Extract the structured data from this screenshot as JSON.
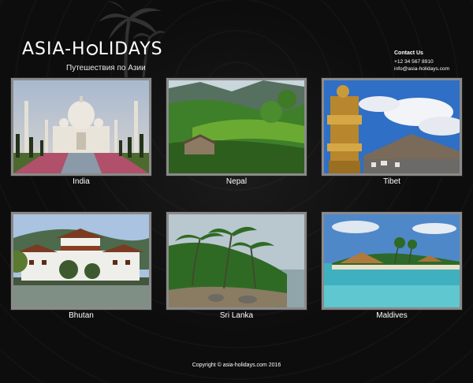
{
  "header": {
    "logo_before": "ASIA-H",
    "logo_after": "LIDAYS",
    "subtitle": "Путешествия по Азии"
  },
  "contact": {
    "title": "Contact Us",
    "phone": "+12 34 567 8910",
    "email": "info@asia-holidays.com"
  },
  "destinations": [
    {
      "name": "India"
    },
    {
      "name": "Nepal"
    },
    {
      "name": "Tibet"
    },
    {
      "name": "Bhutan"
    },
    {
      "name": "Sri Lanka"
    },
    {
      "name": "Maldives"
    }
  ],
  "footer": {
    "copyright": "Copyright © asia-holidays.com 2016"
  },
  "colors": {
    "background": "#0d0d0d",
    "frame": "#8a8a8a",
    "text": "#ffffff"
  },
  "icons": [
    "palm-tree-icon",
    "globe-icon"
  ]
}
